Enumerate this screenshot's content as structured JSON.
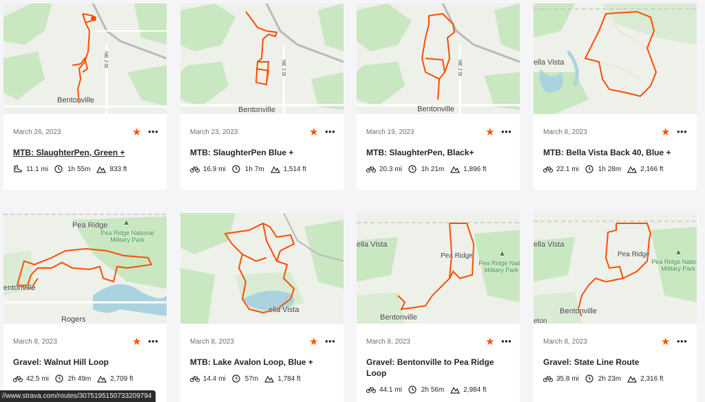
{
  "routes": [
    {
      "date": "March 26, 2023",
      "title": "MTB: SlaughterPen, Green +",
      "distance": "11.1 mi",
      "time": "1h 55m",
      "elevation": "833 ft",
      "activity_icon": "run-shoe-icon",
      "map_labels": [
        "Bentonville",
        "NE J St"
      ]
    },
    {
      "date": "March 23, 2023",
      "title": "MTB: SlaughterPen Blue +",
      "distance": "16.9 mi",
      "time": "1h 7m",
      "elevation": "1,514 ft",
      "activity_icon": "bike-icon",
      "map_labels": [
        "Bentonville",
        "NE J St"
      ]
    },
    {
      "date": "March 19, 2023",
      "title": "MTB: SlaughterPen, Black+",
      "distance": "20.3 mi",
      "time": "1h 21m",
      "elevation": "1,896 ft",
      "activity_icon": "bike-icon",
      "map_labels": [
        "Bentonville",
        "NE J St"
      ]
    },
    {
      "date": "March 8, 2023",
      "title": "MTB: Bella Vista Back 40, Blue +",
      "distance": "22.1 mi",
      "time": "1h 28m",
      "elevation": "2,166 ft",
      "activity_icon": "bike-icon",
      "map_labels": [
        "ella Vista"
      ]
    },
    {
      "date": "March 8, 2023",
      "title": "Gravel: Walnut Hill Loop",
      "distance": "42.5 mi",
      "time": "2h 49m",
      "elevation": "2,709 ft",
      "activity_icon": "bike-icon",
      "map_labels": [
        "Pea Ridge",
        "Pea Ridge National\nMilitary Park",
        "entonville",
        "Rogers"
      ]
    },
    {
      "date": "March 8, 2023",
      "title": "MTB: Lake Avalon Loop, Blue +",
      "distance": "14.4 mi",
      "time": "57m",
      "elevation": "1,784 ft",
      "activity_icon": "bike-icon",
      "map_labels": [
        "ella Vista"
      ]
    },
    {
      "date": "March 8, 2023",
      "title": "Gravel: Bentonville to Pea Ridge Loop",
      "distance": "44.1 mi",
      "time": "2h 56m",
      "elevation": "2,984 ft",
      "activity_icon": "bike-icon",
      "map_labels": [
        "ella Vista",
        "Pea Ridge",
        "Pea Ridge Natio\nMilitary Park",
        "Bentonville"
      ]
    },
    {
      "date": "March 8, 2023",
      "title": "Gravel: State Line Route",
      "distance": "35.8 mi",
      "time": "2h 23m",
      "elevation": "2,316 ft",
      "activity_icon": "bike-icon",
      "map_labels": [
        "ella Vista",
        "Pea Ridge",
        "Pea Ridge National\nMilitary Park",
        "Bentonville",
        "eton"
      ]
    }
  ],
  "status_url": "//www.strava.com/routes/3075195150733209794",
  "colors": {
    "accent": "#fc5200",
    "route": "#fc4c02",
    "park": "#c9e7c1",
    "water": "#aad3df",
    "map_bg": "#eef0ea"
  }
}
